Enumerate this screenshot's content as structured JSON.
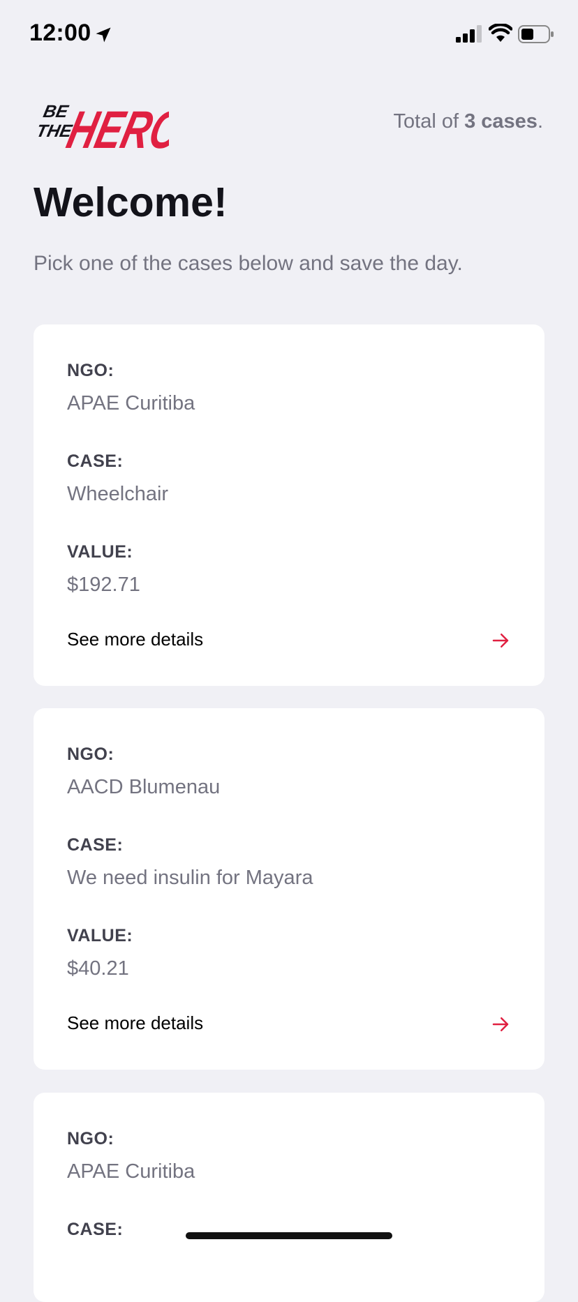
{
  "status_bar": {
    "time": "12:00",
    "icons": [
      "location-arrow-icon",
      "cellular-signal-icon",
      "wifi-icon",
      "battery-icon"
    ]
  },
  "header": {
    "logo_lines": [
      "BE",
      "THE",
      "HERO"
    ],
    "total_prefix": "Total of ",
    "total_count": "3 cases",
    "total_suffix": "."
  },
  "welcome": {
    "title": "Welcome!",
    "subtitle": "Pick one of the cases below and save the day."
  },
  "labels": {
    "ngo": "NGO:",
    "case": "CASE:",
    "value": "VALUE:",
    "details": "See more details"
  },
  "cases": [
    {
      "ngo": "APAE Curitiba",
      "case": "Wheelchair",
      "value": "$192.71"
    },
    {
      "ngo": "AACD Blumenau",
      "case": "We need insulin for Mayara",
      "value": "$40.21"
    },
    {
      "ngo": "APAE Curitiba"
    }
  ],
  "colors": {
    "brand": "#e02041",
    "background": "#f0f0f5",
    "card": "#ffffff",
    "muted_text": "#737380",
    "label_text": "#41414d"
  }
}
